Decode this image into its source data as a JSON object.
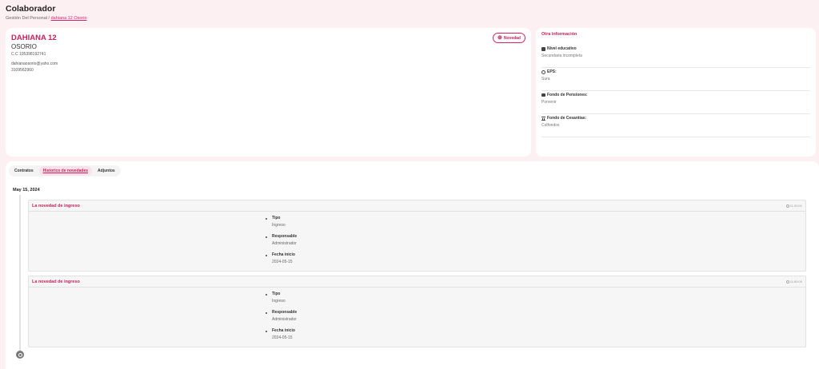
{
  "page": {
    "title": "Colaborador",
    "breadcrumb": [
      "Gestión Del Personal",
      "/",
      "dahiana 12 Osorio"
    ]
  },
  "profile": {
    "name": "DAHIANA 12",
    "surname": "OSORIO",
    "cc": "C.C 105398192741",
    "email": "dahianaosorio@yaho.com",
    "phone": "3109562960",
    "novedad_button": "Novedad"
  },
  "other_info": {
    "title": "Otra información",
    "items": [
      {
        "icon": "book-icon",
        "label": "Nivel educativo",
        "value": "Secundaria incompleta"
      },
      {
        "icon": "stethoscope-icon",
        "label": "EPS:",
        "value": "Sura"
      },
      {
        "icon": "briefcase-icon",
        "label": "Fondo de Pensiones:",
        "value": "Porvenir"
      },
      {
        "icon": "bank-icon",
        "label": "Fondo de Cesantías:",
        "value": "Colfondos"
      }
    ]
  },
  "tabs": [
    "Contratos",
    "Historico de novedades",
    "Adjuntos"
  ],
  "active_tab": "Historico de novedades",
  "timeline": {
    "date": "May 15, 2024",
    "events": [
      {
        "title": "La novedad de ingreso",
        "time": "11:00:01",
        "fields": [
          {
            "label": "Tipo",
            "value": "Ingreso"
          },
          {
            "label": "Responsable",
            "value": "Administrador"
          },
          {
            "label": "Fecha inicio",
            "value": "2024-05-15"
          }
        ]
      },
      {
        "title": "La novedad de ingreso",
        "time": "11:00:00",
        "fields": [
          {
            "label": "Tipo",
            "value": "Ingreso"
          },
          {
            "label": "Responsable",
            "value": "Administrador"
          },
          {
            "label": "Fecha inicio",
            "value": "2024-05-15"
          }
        ]
      }
    ]
  },
  "colors": {
    "accent": "#c8215c",
    "background": "#fdf0f3"
  }
}
